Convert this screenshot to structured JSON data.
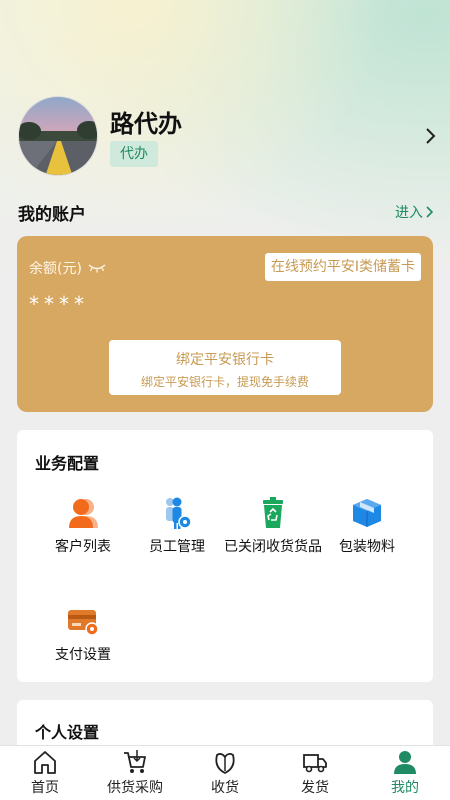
{
  "profile": {
    "name": "路代办",
    "role": "代办"
  },
  "account": {
    "title": "我的账户",
    "enter_label": "进入"
  },
  "card": {
    "balance_label": "余额(元)",
    "bank_tag": "在线预约平安I类储蓄卡",
    "balance_value": "****",
    "bind_title": "绑定平安银行卡",
    "bind_subtitle": "绑定平安银行卡，提现免手续费"
  },
  "business": {
    "title": "业务配置",
    "items": [
      {
        "label": "客户列表",
        "icon": "customer-list-icon"
      },
      {
        "label": "员工管理",
        "icon": "staff-management-icon"
      },
      {
        "label": "已关闭收货货品",
        "icon": "recycle-bin-icon"
      },
      {
        "label": "包装物料",
        "icon": "package-box-icon"
      },
      {
        "label": "支付设置",
        "icon": "payment-card-icon"
      }
    ]
  },
  "personal": {
    "title": "个人设置"
  },
  "tabbar": {
    "tabs": [
      {
        "label": "首页",
        "icon": "home-icon"
      },
      {
        "label": "供货采购",
        "icon": "cart-icon"
      },
      {
        "label": "收货",
        "icon": "receive-icon"
      },
      {
        "label": "发货",
        "icon": "truck-icon"
      },
      {
        "label": "我的",
        "icon": "user-icon"
      }
    ],
    "active_index": 4
  },
  "colors": {
    "accent": "#1f8a63",
    "card_gold": "#d7a862",
    "orange": "#f26b1d",
    "blue": "#1e88e5",
    "green": "#1aa85c"
  }
}
